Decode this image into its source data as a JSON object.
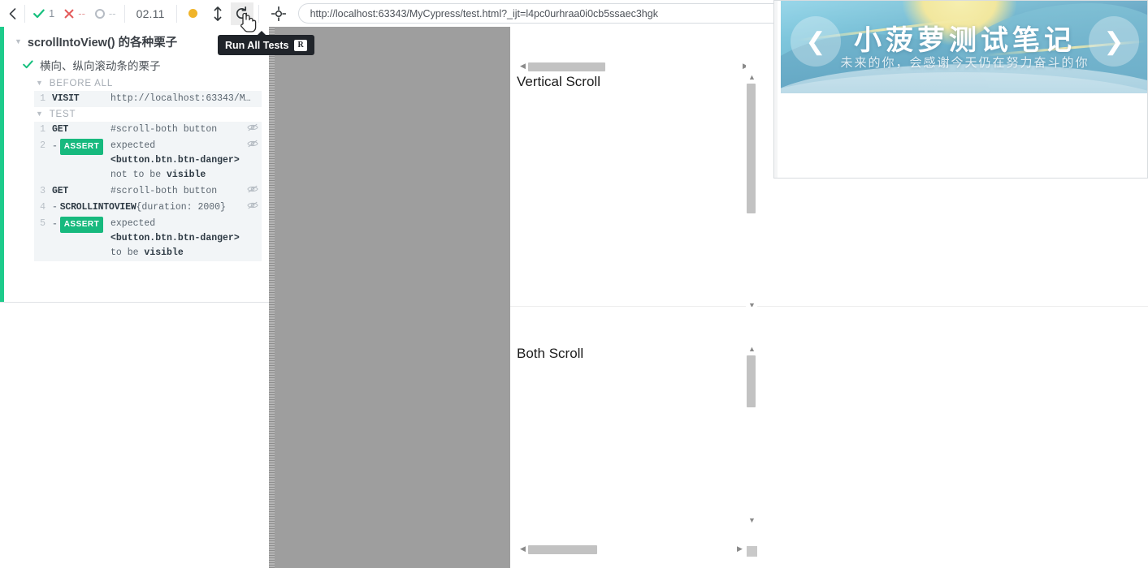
{
  "toolbar": {
    "back_icon": "chevron-left-icon",
    "stats": [
      {
        "name": "passed",
        "icon": "check-icon",
        "value": "1"
      },
      {
        "name": "failed",
        "icon": "times-icon",
        "value": "--"
      },
      {
        "name": "pending",
        "icon": "circle-icon",
        "value": "--"
      }
    ],
    "timer": "02.11",
    "controls": [
      {
        "name": "auto-scroll-dot",
        "icon": "amber-dot-icon",
        "label": ""
      },
      {
        "name": "auto-scroll-toggle",
        "icon": "arrows-vertical-icon",
        "label": ""
      },
      {
        "name": "restart-tests",
        "icon": "reload-icon",
        "label": ""
      }
    ],
    "selector_playground_icon": "crosshair-target-icon",
    "url": "http://localhost:63343/MyCypress/test.html?_ijt=l4pc0urhraa0i0cb5ssaec3hgk",
    "url_placeholder": "http://localhost"
  },
  "tooltip": {
    "label": "Run All Tests",
    "shortcut": "R"
  },
  "reporter": {
    "accent_color": "#1ecb8b",
    "suite_title": "scrollIntoView() 的各种栗子",
    "test_title": "横向、纵向滚动条的栗子",
    "hooks": [
      {
        "label": "BEFORE ALL"
      },
      {
        "label": "TEST"
      }
    ],
    "before_all_commands": [
      {
        "num": "1",
        "name": "VISIT",
        "message": "http://localhost:63343/M…",
        "child": false,
        "eye": false,
        "assert": false
      }
    ],
    "test_commands": [
      {
        "num": "1",
        "name": "GET",
        "message": "#scroll-both button",
        "child": false,
        "eye": true,
        "assert": false
      },
      {
        "num": "2",
        "name": "ASSERT",
        "message": "expected <button.btn.btn-danger> not to be visible",
        "msg_parts": [
          {
            "text": "expected ",
            "strong": false
          },
          {
            "text": "<button.btn.btn-danger>",
            "strong": true
          },
          {
            "text": " not to be ",
            "strong": false
          },
          {
            "text": "visible",
            "strong": true
          }
        ],
        "child": true,
        "eye": true,
        "assert": true
      },
      {
        "num": "3",
        "name": "GET",
        "message": "#scroll-both button",
        "child": false,
        "eye": true,
        "assert": false
      },
      {
        "num": "4",
        "name": "SCROLLINTOVIEW",
        "message": "{duration: 2000}",
        "child": true,
        "eye": true,
        "assert": false
      },
      {
        "num": "5",
        "name": "ASSERT",
        "message": "expected <button.btn.btn-danger> to be visible",
        "msg_parts": [
          {
            "text": "expected ",
            "strong": false
          },
          {
            "text": "<button.btn.btn-danger>",
            "strong": true
          },
          {
            "text": " to be ",
            "strong": false
          },
          {
            "text": "visible",
            "strong": true
          }
        ],
        "child": true,
        "eye": true,
        "assert": true
      }
    ]
  },
  "app": {
    "sections": [
      {
        "name": "vertical-scroll",
        "title": "Vertical Scroll"
      },
      {
        "name": "both-scroll",
        "title": "Both Scroll"
      }
    ],
    "backdrop_color": "#9e9e9e"
  },
  "banner": {
    "title": "小菠萝测试笔记",
    "subtitle": "未来的你，会感谢今天仍在努力奋斗的你",
    "prev_icon": "chevron-left-icon",
    "next_icon": "chevron-right-icon",
    "prev_glyph": "❮",
    "next_glyph": "❯"
  }
}
